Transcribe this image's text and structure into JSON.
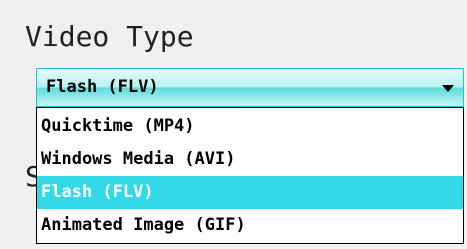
{
  "section": {
    "title": "Video Type",
    "next_title_partial": "S"
  },
  "combo": {
    "selected_value": "Flash (FLV)",
    "arrow_icon": "chevron-down-icon"
  },
  "dropdown": {
    "options": [
      {
        "label": "Quicktime (MP4)",
        "selected": false
      },
      {
        "label": "Windows Media (AVI)",
        "selected": false
      },
      {
        "label": "Flash (FLV)",
        "selected": true
      },
      {
        "label": "Animated Image (GIF)",
        "selected": false
      }
    ]
  },
  "colors": {
    "highlight": "#33d9e6",
    "combo_border": "#29c1c9",
    "background": "#f0f0f0"
  }
}
